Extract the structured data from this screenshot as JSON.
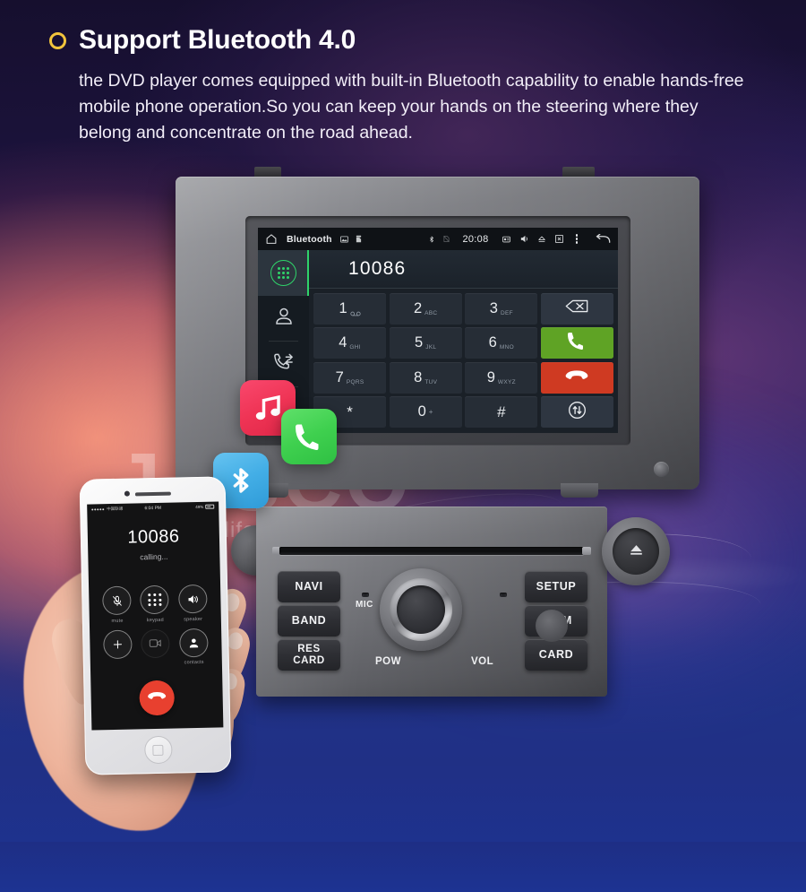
{
  "header": {
    "bullet_icon": "ring-bullet-icon",
    "bullet_color": "#f2c43c",
    "title": "Support Bluetooth 4.0",
    "body": "the DVD player comes equipped with built-in Bluetooth capability to enable hands-free mobile phone operation.So you can keep your hands on the steering where they belong and concentrate on the  road ahead."
  },
  "watermark": {
    "brand": "JASCO",
    "tagline": "Enjoy car life 智佳乐"
  },
  "head_unit": {
    "status_bar": {
      "home_icon": "home-icon",
      "app_label": "Bluetooth",
      "gallery_icon": "gallery-icon",
      "storage_icon": "storage-icon",
      "bluetooth_icon": "bluetooth-icon",
      "sim_off_icon": "sim-off-icon",
      "time": "20:08",
      "radio_icon": "radio-icon",
      "volume_icon": "volume-icon",
      "eject_icon": "eject-icon",
      "close_icon": "close-box-icon",
      "overflow_icon": "overflow-menu-icon",
      "back_icon": "back-arrow-icon"
    },
    "sidebar": [
      {
        "name": "dialpad",
        "icon": "dialpad-icon",
        "active": true
      },
      {
        "name": "contacts",
        "icon": "contact-icon",
        "active": false
      },
      {
        "name": "call-history",
        "icon": "call-history-icon",
        "active": false
      },
      {
        "name": "search",
        "icon": "search-icon",
        "active": false
      }
    ],
    "accent_color": "#2fd36a",
    "dialed_number": "10086",
    "keys": [
      {
        "digit": "1",
        "sub": "",
        "icon": "voicemail-icon"
      },
      {
        "digit": "2",
        "sub": "ABC",
        "icon": ""
      },
      {
        "digit": "3",
        "sub": "DEF",
        "icon": ""
      },
      {
        "digit": "",
        "sub": "",
        "icon": "backspace-icon",
        "style": "act"
      },
      {
        "digit": "4",
        "sub": "GHI",
        "icon": ""
      },
      {
        "digit": "5",
        "sub": "JKL",
        "icon": ""
      },
      {
        "digit": "6",
        "sub": "MNO",
        "icon": ""
      },
      {
        "digit": "",
        "sub": "",
        "icon": "call-icon",
        "style": "green"
      },
      {
        "digit": "7",
        "sub": "PQRS",
        "icon": ""
      },
      {
        "digit": "8",
        "sub": "TUV",
        "icon": ""
      },
      {
        "digit": "9",
        "sub": "WXYZ",
        "icon": ""
      },
      {
        "digit": "",
        "sub": "",
        "icon": "hangup-icon",
        "style": "red"
      },
      {
        "digit": "*",
        "sub": "",
        "icon": ""
      },
      {
        "digit": "0",
        "sub": "+",
        "icon": ""
      },
      {
        "digit": "#",
        "sub": "",
        "icon": ""
      },
      {
        "digit": "",
        "sub": "",
        "icon": "audio-transfer-icon",
        "style": "act"
      }
    ],
    "key_colors": {
      "call": "#5fa325",
      "hangup": "#cf3a22",
      "default": "#262d36"
    }
  },
  "app_icons": [
    {
      "name": "music-app-icon",
      "glyph": "music-note-icon",
      "color": "#ef3455"
    },
    {
      "name": "phone-app-icon",
      "glyph": "phone-handset-icon",
      "color": "#3fd04f"
    },
    {
      "name": "bluetooth-app-icon",
      "glyph": "bluetooth-icon",
      "color": "#43aee6"
    }
  ],
  "iphone": {
    "status": {
      "carrier": "中国联通",
      "time": "6:04 PM",
      "battery": "49%"
    },
    "number": "10086",
    "state": "calling...",
    "buttons": [
      {
        "label": "mute",
        "icon": "mute-mic-icon",
        "dim": false
      },
      {
        "label": "keypad",
        "icon": "dialpad-icon",
        "dim": false
      },
      {
        "label": "speaker",
        "icon": "speaker-icon",
        "dim": false
      },
      {
        "label": "",
        "icon": "add-call-icon",
        "dim": false
      },
      {
        "label": "",
        "icon": "facetime-icon",
        "dim": true
      },
      {
        "label": "contacts",
        "icon": "contact-icon",
        "dim": false
      }
    ],
    "end_call_icon": "hangup-icon",
    "end_call_color": "#e8402f",
    "home_button_icon": "home-button-icon"
  },
  "control_panel": {
    "left_buttons": [
      {
        "label": "NAVI",
        "label2": ""
      },
      {
        "label": "BAND",
        "label2": ""
      },
      {
        "label": "RES",
        "label2": "CARD"
      }
    ],
    "right_buttons": [
      {
        "label": "SETUP",
        "label2": ""
      },
      {
        "label": "DIMM",
        "label2": ""
      },
      {
        "label": "CARD",
        "label2": ""
      }
    ],
    "mic_label": "MIC",
    "pow_label": "POW",
    "vol_label": "VOL",
    "eject_icon": "eject-icon",
    "disc_slot": "disc-slot"
  }
}
